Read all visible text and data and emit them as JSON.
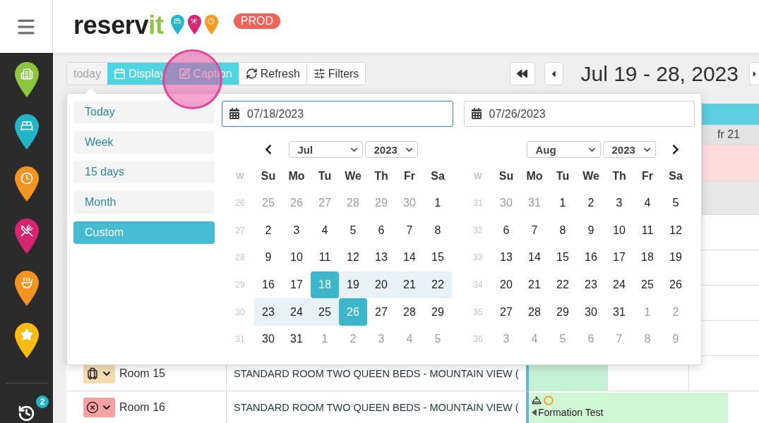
{
  "header": {
    "logo": {
      "main": "reserv",
      "accent": "it"
    },
    "environment": "PROD"
  },
  "sidebar": {
    "items": [
      {
        "kind": "building",
        "color": "#8cc63f"
      },
      {
        "kind": "bed",
        "color": "#22b5c7"
      },
      {
        "kind": "clock",
        "color": "#f39420"
      },
      {
        "kind": "dining",
        "color": "#d6246e"
      },
      {
        "kind": "soup",
        "color": "#f39420"
      },
      {
        "kind": "star",
        "color": "#f8bb10"
      }
    ],
    "history_badge": "2"
  },
  "toolbar": {
    "buttons": [
      {
        "label": "today",
        "kind": "plain",
        "disabled": true,
        "highlighted": false
      },
      {
        "label": "Display",
        "kind": "calendar",
        "disabled": false,
        "highlighted": true
      },
      {
        "label": "Caption",
        "kind": "edit",
        "disabled": false,
        "highlighted": true
      },
      {
        "label": "Refresh",
        "kind": "refresh",
        "disabled": false,
        "highlighted": false
      },
      {
        "label": "Filters",
        "kind": "filters",
        "disabled": false,
        "highlighted": false
      }
    ]
  },
  "navigation": {
    "before": [
      {
        "kind": "first"
      },
      {
        "kind": "prev"
      }
    ],
    "title": "Jul 19 - 28, 2023",
    "after": [
      {
        "kind": "next"
      }
    ]
  },
  "schedule": {
    "rows": [
      {
        "kind": "band"
      },
      {
        "kind": "days",
        "label": "fr 21"
      },
      {
        "kind": "alert"
      },
      {
        "kind": "summary"
      },
      {
        "kind": "room"
      },
      {
        "kind": "room"
      },
      {
        "kind": "room"
      },
      {
        "kind": "room"
      },
      {
        "kind": "room",
        "status": {
          "kind": "luggage",
          "color": "#f5dcb4"
        },
        "name": "Room 15",
        "type": "STANDARD ROOM TWO QUEEN BEDS - MOUNTAIN VIEW (",
        "cells": [
          {
            "booked": true
          },
          {
            "booked": false
          },
          {
            "booked": false
          }
        ]
      },
      {
        "kind": "room",
        "status": {
          "kind": "blocked",
          "color": "#f7a2a2"
        },
        "name": "Room 16",
        "type": "STANDARD ROOM TWO QUEEN BEDS - MOUNTAIN VIEW (",
        "cells": [
          {
            "booked": false
          },
          {
            "booked": false
          },
          {
            "booked": false
          }
        ],
        "booking": {
          "label": "Formation Test",
          "continues_before": true
        }
      }
    ]
  },
  "popup": {
    "presets": [
      {
        "label": "Today",
        "selected": false
      },
      {
        "label": "Week",
        "selected": false
      },
      {
        "label": "15 days",
        "selected": false
      },
      {
        "label": "Month",
        "selected": false
      },
      {
        "label": "Custom",
        "selected": true
      }
    ],
    "start_date": {
      "value": "07/18/2023",
      "focused": true
    },
    "end_date": {
      "value": "07/26/2023",
      "focused": false
    },
    "calendars": [
      {
        "kind": "prev",
        "month": "Jul",
        "year": "2023",
        "week_label": "W",
        "weekdays": [
          "Su",
          "Mo",
          "Tu",
          "We",
          "Th",
          "Fr",
          "Sa"
        ],
        "weeks": [
          {
            "number": "26",
            "days": [
              {
                "label": "25",
                "outside": true,
                "selected": false,
                "in_range": false
              },
              {
                "label": "26",
                "outside": true,
                "selected": false,
                "in_range": false
              },
              {
                "label": "27",
                "outside": true,
                "selected": false,
                "in_range": false
              },
              {
                "label": "28",
                "outside": true,
                "selected": false,
                "in_range": false
              },
              {
                "label": "29",
                "outside": true,
                "selected": false,
                "in_range": false
              },
              {
                "label": "30",
                "outside": true,
                "selected": false,
                "in_range": false
              },
              {
                "label": "1",
                "outside": false,
                "selected": false,
                "in_range": false
              }
            ]
          },
          {
            "number": "27",
            "days": [
              {
                "label": "2",
                "outside": false,
                "selected": false,
                "in_range": false
              },
              {
                "label": "3",
                "outside": false,
                "selected": false,
                "in_range": false
              },
              {
                "label": "4",
                "outside": false,
                "selected": false,
                "in_range": false
              },
              {
                "label": "5",
                "outside": false,
                "selected": false,
                "in_range": false
              },
              {
                "label": "6",
                "outside": false,
                "selected": false,
                "in_range": false
              },
              {
                "label": "7",
                "outside": false,
                "selected": false,
                "in_range": false
              },
              {
                "label": "8",
                "outside": false,
                "selected": false,
                "in_range": false
              }
            ]
          },
          {
            "number": "28",
            "days": [
              {
                "label": "9",
                "outside": false,
                "selected": false,
                "in_range": false
              },
              {
                "label": "10",
                "outside": false,
                "selected": false,
                "in_range": false
              },
              {
                "label": "11",
                "outside": false,
                "selected": false,
                "in_range": false
              },
              {
                "label": "12",
                "outside": false,
                "selected": false,
                "in_range": false
              },
              {
                "label": "13",
                "outside": false,
                "selected": false,
                "in_range": false
              },
              {
                "label": "14",
                "outside": false,
                "selected": false,
                "in_range": false
              },
              {
                "label": "15",
                "outside": false,
                "selected": false,
                "in_range": false
              }
            ]
          },
          {
            "number": "29",
            "days": [
              {
                "label": "16",
                "outside": false,
                "selected": false,
                "in_range": false
              },
              {
                "label": "17",
                "outside": false,
                "selected": false,
                "in_range": false
              },
              {
                "label": "18",
                "outside": false,
                "selected": true,
                "in_range": false
              },
              {
                "label": "19",
                "outside": false,
                "selected": false,
                "in_range": true
              },
              {
                "label": "20",
                "outside": false,
                "selected": false,
                "in_range": true
              },
              {
                "label": "21",
                "outside": false,
                "selected": false,
                "in_range": true
              },
              {
                "label": "22",
                "outside": false,
                "selected": false,
                "in_range": true
              }
            ]
          },
          {
            "number": "30",
            "days": [
              {
                "label": "23",
                "outside": false,
                "selected": false,
                "in_range": true
              },
              {
                "label": "24",
                "outside": false,
                "selected": false,
                "in_range": true
              },
              {
                "label": "25",
                "outside": false,
                "selected": false,
                "in_range": true
              },
              {
                "label": "26",
                "outside": false,
                "selected": true,
                "in_range": false
              },
              {
                "label": "27",
                "outside": false,
                "selected": false,
                "in_range": false
              },
              {
                "label": "28",
                "outside": false,
                "selected": false,
                "in_range": false
              },
              {
                "label": "29",
                "outside": false,
                "selected": false,
                "in_range": false
              }
            ]
          },
          {
            "number": "31",
            "days": [
              {
                "label": "30",
                "outside": false,
                "selected": false,
                "in_range": false
              },
              {
                "label": "31",
                "outside": false,
                "selected": false,
                "in_range": false
              },
              {
                "label": "1",
                "outside": true,
                "selected": false,
                "in_range": false
              },
              {
                "label": "2",
                "outside": true,
                "selected": false,
                "in_range": false
              },
              {
                "label": "3",
                "outside": true,
                "selected": false,
                "in_range": false
              },
              {
                "label": "4",
                "outside": true,
                "selected": false,
                "in_range": false
              },
              {
                "label": "5",
                "outside": true,
                "selected": false,
                "in_range": false
              }
            ]
          }
        ]
      },
      {
        "kind": "next",
        "month": "Aug",
        "year": "2023",
        "week_label": "W",
        "weekdays": [
          "Su",
          "Mo",
          "Tu",
          "We",
          "Th",
          "Fr",
          "Sa"
        ],
        "weeks": [
          {
            "number": "31",
            "days": [
              {
                "label": "30",
                "outside": true,
                "selected": false,
                "in_range": false
              },
              {
                "label": "31",
                "outside": true,
                "selected": false,
                "in_range": false
              },
              {
                "label": "1",
                "outside": false,
                "selected": false,
                "in_range": false
              },
              {
                "label": "2",
                "outside": false,
                "selected": false,
                "in_range": false
              },
              {
                "label": "3",
                "outside": false,
                "selected": false,
                "in_range": false
              },
              {
                "label": "4",
                "outside": false,
                "selected": false,
                "in_range": false
              },
              {
                "label": "5",
                "outside": false,
                "selected": false,
                "in_range": false
              }
            ]
          },
          {
            "number": "32",
            "days": [
              {
                "label": "6",
                "outside": false,
                "selected": false,
                "in_range": false
              },
              {
                "label": "7",
                "outside": false,
                "selected": false,
                "in_range": false
              },
              {
                "label": "8",
                "outside": false,
                "selected": false,
                "in_range": false
              },
              {
                "label": "9",
                "outside": false,
                "selected": false,
                "in_range": false
              },
              {
                "label": "10",
                "outside": false,
                "selected": false,
                "in_range": false
              },
              {
                "label": "11",
                "outside": false,
                "selected": false,
                "in_range": false
              },
              {
                "label": "12",
                "outside": false,
                "selected": false,
                "in_range": false
              }
            ]
          },
          {
            "number": "33",
            "days": [
              {
                "label": "13",
                "outside": false,
                "selected": false,
                "in_range": false
              },
              {
                "label": "14",
                "outside": false,
                "selected": false,
                "in_range": false
              },
              {
                "label": "15",
                "outside": false,
                "selected": false,
                "in_range": false
              },
              {
                "label": "16",
                "outside": false,
                "selected": false,
                "in_range": false
              },
              {
                "label": "17",
                "outside": false,
                "selected": false,
                "in_range": false
              },
              {
                "label": "18",
                "outside": false,
                "selected": false,
                "in_range": false
              },
              {
                "label": "19",
                "outside": false,
                "selected": false,
                "in_range": false
              }
            ]
          },
          {
            "number": "34",
            "days": [
              {
                "label": "20",
                "outside": false,
                "selected": false,
                "in_range": false
              },
              {
                "label": "21",
                "outside": false,
                "selected": false,
                "in_range": false
              },
              {
                "label": "22",
                "outside": false,
                "selected": false,
                "in_range": false
              },
              {
                "label": "23",
                "outside": false,
                "selected": false,
                "in_range": false
              },
              {
                "label": "24",
                "outside": false,
                "selected": false,
                "in_range": false
              },
              {
                "label": "25",
                "outside": false,
                "selected": false,
                "in_range": false
              },
              {
                "label": "26",
                "outside": false,
                "selected": false,
                "in_range": false
              }
            ]
          },
          {
            "number": "35",
            "days": [
              {
                "label": "27",
                "outside": false,
                "selected": false,
                "in_range": false
              },
              {
                "label": "28",
                "outside": false,
                "selected": false,
                "in_range": false
              },
              {
                "label": "29",
                "outside": false,
                "selected": false,
                "in_range": false
              },
              {
                "label": "30",
                "outside": false,
                "selected": false,
                "in_range": false
              },
              {
                "label": "31",
                "outside": false,
                "selected": false,
                "in_range": false
              },
              {
                "label": "1",
                "outside": true,
                "selected": false,
                "in_range": false
              },
              {
                "label": "2",
                "outside": true,
                "selected": false,
                "in_range": false
              }
            ]
          },
          {
            "number": "36",
            "days": [
              {
                "label": "3",
                "outside": true,
                "selected": false,
                "in_range": false
              },
              {
                "label": "4",
                "outside": true,
                "selected": false,
                "in_range": false
              },
              {
                "label": "5",
                "outside": true,
                "selected": false,
                "in_range": false
              },
              {
                "label": "6",
                "outside": true,
                "selected": false,
                "in_range": false
              },
              {
                "label": "7",
                "outside": true,
                "selected": false,
                "in_range": false
              },
              {
                "label": "8",
                "outside": true,
                "selected": false,
                "in_range": false
              },
              {
                "label": "9",
                "outside": true,
                "selected": false,
                "in_range": false
              }
            ]
          }
        ]
      }
    ]
  }
}
